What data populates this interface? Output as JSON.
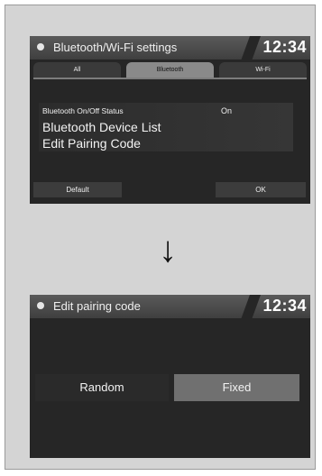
{
  "screen1": {
    "title": "Bluetooth/Wi-Fi settings",
    "clock": "12:34",
    "tabs": [
      {
        "label": "All"
      },
      {
        "label": "Bluetooth",
        "active": true
      },
      {
        "label": "Wi-Fi"
      }
    ],
    "bluetooth_status_label": "Bluetooth On/Off Status",
    "bluetooth_status_value": "On",
    "device_list_label": "Bluetooth Device List",
    "edit_pairing_label": "Edit Pairing Code",
    "default_label": "Default",
    "ok_label": "OK"
  },
  "arrow_icon": "↓",
  "screen2": {
    "title": "Edit pairing code",
    "clock": "12:34",
    "random_label": "Random",
    "fixed_label": "Fixed",
    "selected": "Fixed"
  }
}
